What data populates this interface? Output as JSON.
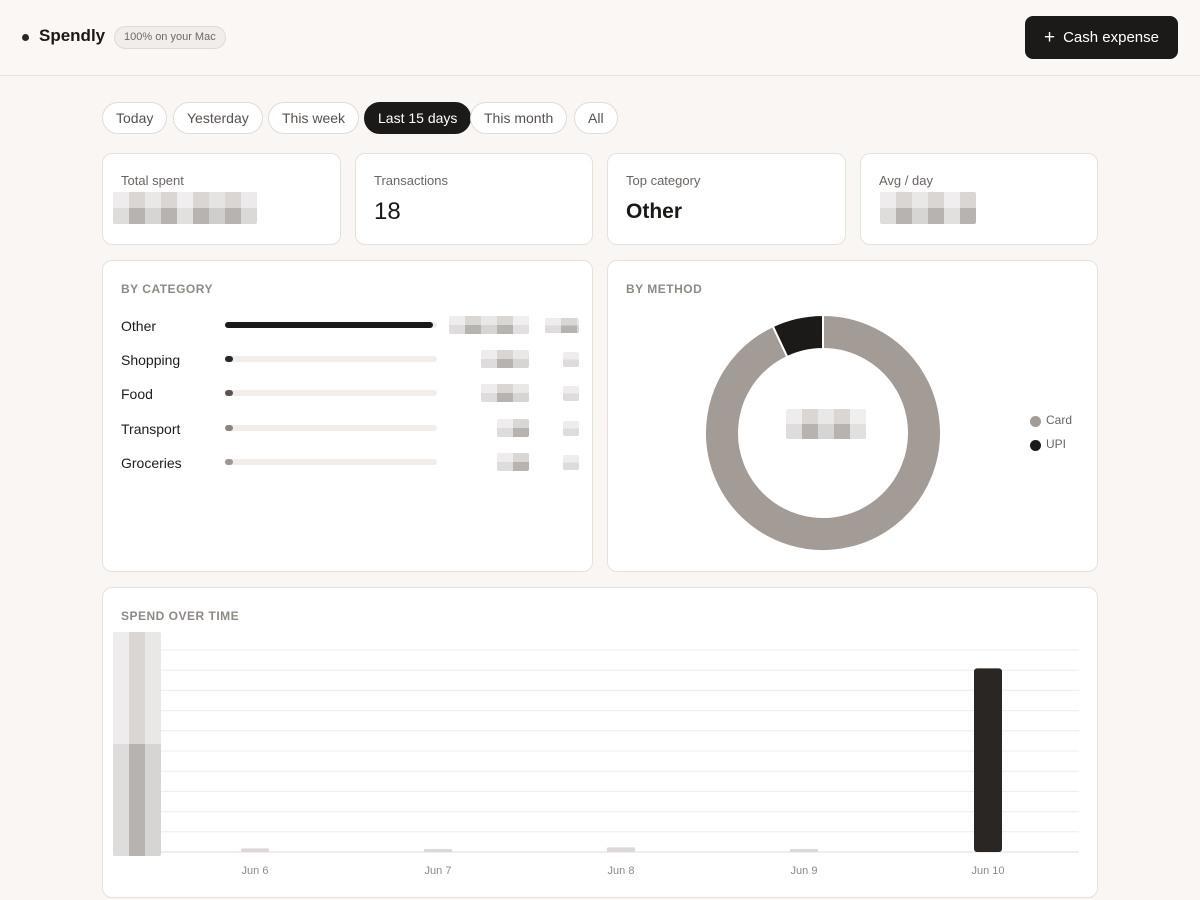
{
  "app": {
    "name": "Spendly",
    "badge": "100% on your Mac"
  },
  "header": {
    "cash_expense_label": "Cash expense"
  },
  "filters": [
    {
      "label": "Today",
      "active": false
    },
    {
      "label": "Yesterday",
      "active": false
    },
    {
      "label": "This week",
      "active": false
    },
    {
      "label": "Last 15 days",
      "active": true
    },
    {
      "label": "This month",
      "active": false
    },
    {
      "label": "All",
      "active": false
    }
  ],
  "stats": {
    "total_spent": {
      "label": "Total spent"
    },
    "transactions": {
      "label": "Transactions",
      "value": "18"
    },
    "top_category": {
      "label": "Top category",
      "value": "Other"
    },
    "avg_day": {
      "label": "Avg / day"
    }
  },
  "by_category": {
    "title": "BY CATEGORY",
    "items": [
      {
        "label": "Other",
        "share": 0.98,
        "color": "#1c1a19"
      },
      {
        "label": "Shopping",
        "share": 0.04,
        "color": "#2b2725"
      },
      {
        "label": "Food",
        "share": 0.03,
        "color": "#5a5552"
      },
      {
        "label": "Transport",
        "share": 0.03,
        "color": "#8a8582"
      },
      {
        "label": "Groceries",
        "share": 0.03,
        "color": "#9c9793"
      }
    ]
  },
  "by_method": {
    "title": "BY METHOD",
    "legend": [
      {
        "label": "Card",
        "color": "#a29b96"
      },
      {
        "label": "UPI",
        "color": "#1c1a19"
      }
    ]
  },
  "spend_over_time": {
    "title": "SPEND OVER TIME"
  },
  "chart_data": [
    {
      "type": "pie",
      "title": "BY METHOD",
      "categories": [
        "Card",
        "UPI"
      ],
      "values": [
        93,
        7
      ],
      "colors": [
        "#a29b96",
        "#1c1a19"
      ],
      "donut": true,
      "legend": "right"
    },
    {
      "type": "bar",
      "title": "SPEND OVER TIME",
      "categories": [
        "Jun 6",
        "Jun 7",
        "Jun 8",
        "Jun 9",
        "Jun 10"
      ],
      "values": [
        2,
        1.5,
        2.5,
        1,
        100
      ],
      "ylim": [
        0,
        110
      ],
      "grid": true,
      "bar_color": "#2a2624",
      "minor_bar_color": "#dcd8d5"
    }
  ]
}
